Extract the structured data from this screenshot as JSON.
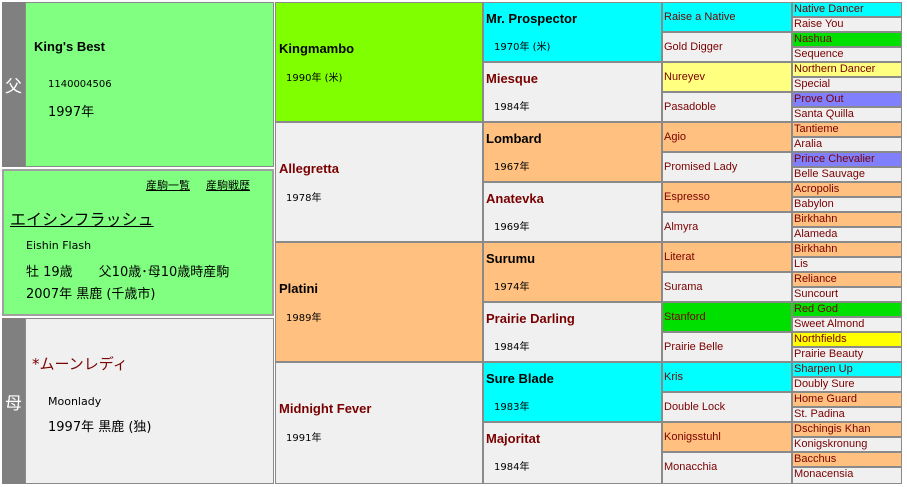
{
  "sire_label": "父",
  "dam_label": "母",
  "sire": {
    "name": "King's Best",
    "id": "1140004506",
    "year": "1997年"
  },
  "horse": {
    "links": [
      "産駒一覧",
      "産駒戦歴"
    ],
    "name_jp": "エイシンフラッシュ",
    "name_en": "Eishin Flash",
    "info1": "牡 19歳　　父10歳･母10歳時産駒",
    "info2": "2007年 黒鹿 (千歳市)"
  },
  "dam": {
    "name": "*ムーンレディ",
    "name_en": "Moonlady",
    "year": "1997年 黒鹿 (独)"
  },
  "gen2": [
    {
      "name": "Kingmambo",
      "year": "1990年 (米)"
    },
    {
      "name": "Allegretta",
      "year": "1978年"
    },
    {
      "name": "Platini",
      "year": "1989年"
    },
    {
      "name": "Midnight Fever",
      "year": "1991年"
    }
  ],
  "gen3": [
    {
      "name": "Mr. Prospector",
      "year": "1970年 (米)"
    },
    {
      "name": "Miesque",
      "year": "1984年"
    },
    {
      "name": "Lombard",
      "year": "1967年"
    },
    {
      "name": "Anatevka",
      "year": "1969年"
    },
    {
      "name": "Surumu",
      "year": "1974年"
    },
    {
      "name": "Prairie Darling",
      "year": "1984年"
    },
    {
      "name": "Sure Blade",
      "year": "1983年"
    },
    {
      "name": "Majoritat",
      "year": "1984年"
    }
  ],
  "gen4": [
    "Raise a Native",
    "Gold Digger",
    "Nureyev",
    "Pasadoble",
    "Agio",
    "Promised Lady",
    "Espresso",
    "Almyra",
    "Literat",
    "Surama",
    "Stanford",
    "Prairie Belle",
    "Kris",
    "Double Lock",
    "Konigsstuhl",
    "Monacchia"
  ],
  "gen5": [
    "Native Dancer",
    "Raise You",
    "Nashua",
    "Sequence",
    "Northern Dancer",
    "Special",
    "Prove Out",
    "Santa Quilla",
    "Tantieme",
    "Aralia",
    "Prince Chevalier",
    "Belle Sauvage",
    "Acropolis",
    "Babylon",
    "Birkhahn",
    "Alameda",
    "Birkhahn",
    "Lis",
    "Reliance",
    "Suncourt",
    "Red God",
    "Sweet Almond",
    "Northfields",
    "Prairie Beauty",
    "Sharpen Up",
    "Doubly Sure",
    "Home Guard",
    "St. Padina",
    "Dschingis Khan",
    "Konigskronung",
    "Bacchus",
    "Monacensia"
  ],
  "colors": {
    "sidebar": "#808080",
    "self": "#80ff80",
    "lime": "#80ff00",
    "cyan": "#00ffff",
    "orange": "#ffc080",
    "gray": "#f0f0f0"
  }
}
